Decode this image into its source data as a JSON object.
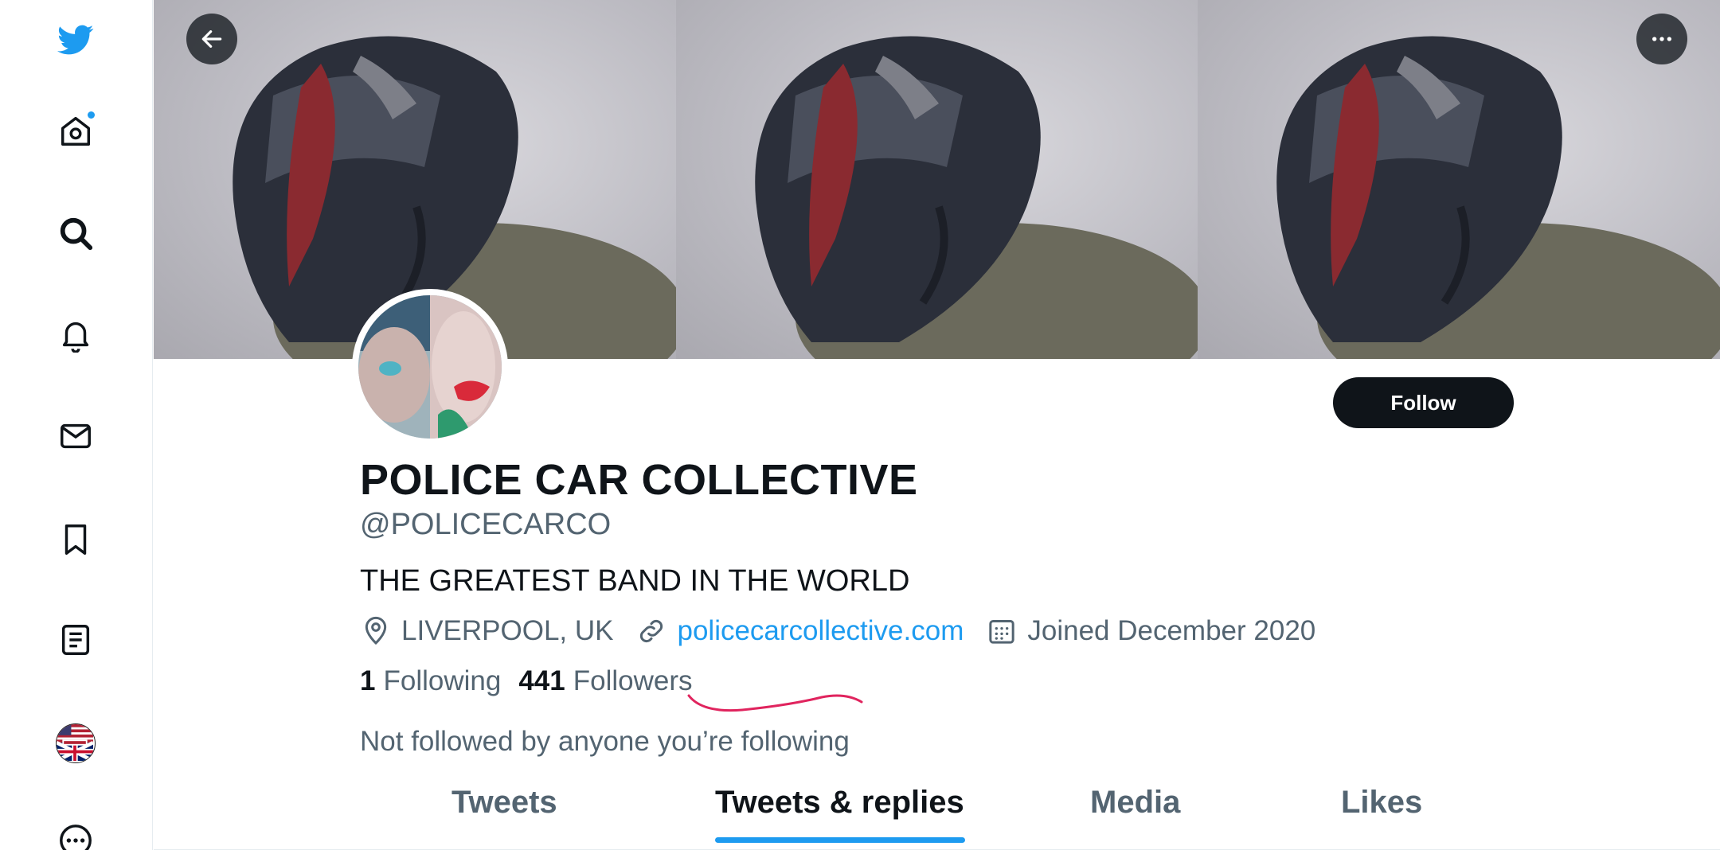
{
  "colors": {
    "brand": "#1d9bf0",
    "text": "#0f1419",
    "secondary": "#536471",
    "scribble": "#e0245e"
  },
  "sidebar": {
    "items": [
      {
        "name": "twitter-logo-icon"
      },
      {
        "name": "home-icon",
        "has_notification": true
      },
      {
        "name": "search-icon"
      },
      {
        "name": "bell-icon"
      },
      {
        "name": "mail-icon"
      },
      {
        "name": "bookmark-icon"
      },
      {
        "name": "lists-icon"
      },
      {
        "name": "avatar"
      },
      {
        "name": "more-icon"
      }
    ]
  },
  "header": {
    "back_icon": "arrow-left-icon",
    "more_icon": "ellipsis-icon"
  },
  "profile": {
    "display_name": "POLICE CAR COLLECTIVE",
    "handle": "@POLICECARCO",
    "bio": "THE GREATEST BAND IN THE WORLD",
    "location": "LIVERPOOL, UK",
    "website": "policecarcollective.com",
    "joined": "Joined December 2020",
    "following_count": "1",
    "following_label": "Following",
    "followers_count": "441",
    "followers_label": "Followers",
    "not_followed_text": "Not followed by anyone you’re following",
    "follow_button": "Follow"
  },
  "tabs": [
    {
      "label": "Tweets",
      "active": false
    },
    {
      "label": "Tweets & replies",
      "active": true
    },
    {
      "label": "Media",
      "active": false
    },
    {
      "label": "Likes",
      "active": false
    }
  ]
}
